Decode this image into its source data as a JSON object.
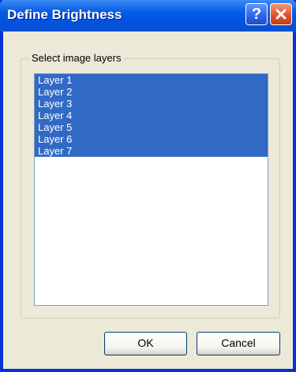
{
  "window": {
    "title": "Define Brightness"
  },
  "titlebar": {
    "help_label": "?"
  },
  "group": {
    "label": "Select image layers",
    "items": [
      {
        "label": "Layer 1"
      },
      {
        "label": "Layer 2"
      },
      {
        "label": "Layer 3"
      },
      {
        "label": "Layer 4"
      },
      {
        "label": "Layer 5"
      },
      {
        "label": "Layer 6"
      },
      {
        "label": "Layer 7"
      }
    ]
  },
  "buttons": {
    "ok_label": "OK",
    "cancel_label": "Cancel"
  },
  "colors": {
    "selection": "#316AC5",
    "titlebar": "#0054E3",
    "face": "#ECE9D8"
  }
}
